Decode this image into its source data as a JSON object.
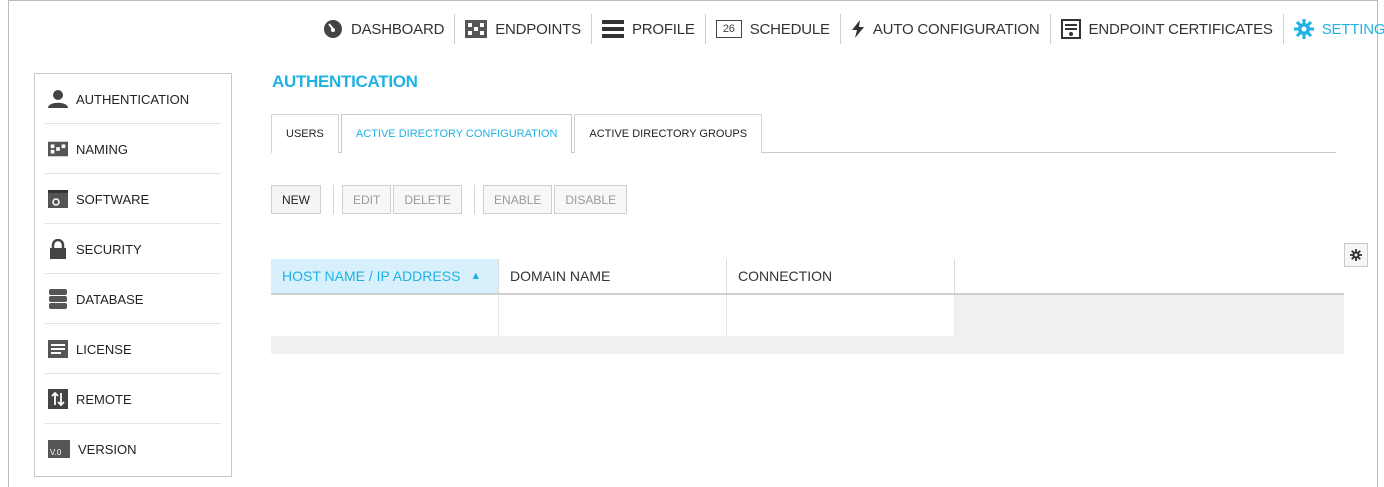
{
  "nav": {
    "items": [
      {
        "label": "DASHBOARD",
        "icon": "dashboard-icon"
      },
      {
        "label": "ENDPOINTS",
        "icon": "endpoints-icon"
      },
      {
        "label": "PROFILE",
        "icon": "profile-icon"
      },
      {
        "label": "SCHEDULE",
        "icon": "calendar-icon",
        "icon_text": "26"
      },
      {
        "label": "AUTO CONFIGURATION",
        "icon": "lightning-icon"
      },
      {
        "label": "ENDPOINT CERTIFICATES",
        "icon": "certificate-icon"
      },
      {
        "label": "SETTINGS",
        "icon": "gear-icon",
        "active": true
      }
    ]
  },
  "sidebar": {
    "items": [
      {
        "label": "AUTHENTICATION",
        "icon": "user-icon"
      },
      {
        "label": "NAMING",
        "icon": "naming-icon"
      },
      {
        "label": "SOFTWARE",
        "icon": "software-icon"
      },
      {
        "label": "SECURITY",
        "icon": "lock-icon"
      },
      {
        "label": "DATABASE",
        "icon": "database-icon"
      },
      {
        "label": "LICENSE",
        "icon": "license-icon"
      },
      {
        "label": "REMOTE",
        "icon": "remote-icon"
      },
      {
        "label": "VERSION",
        "icon": "version-icon",
        "icon_text": "V.0"
      }
    ]
  },
  "main": {
    "title": "AUTHENTICATION",
    "tabs": [
      {
        "label": "USERS"
      },
      {
        "label": "ACTIVE DIRECTORY CONFIGURATION",
        "active": true
      },
      {
        "label": "ACTIVE DIRECTORY GROUPS"
      }
    ],
    "toolbar": {
      "new": "NEW",
      "edit": "EDIT",
      "delete": "DELETE",
      "enable": "ENABLE",
      "disable": "DISABLE"
    },
    "table": {
      "columns": [
        {
          "label": "HOST NAME / IP ADDRESS",
          "sorted": "asc"
        },
        {
          "label": "DOMAIN NAME"
        },
        {
          "label": "CONNECTION"
        },
        {
          "label": ""
        }
      ],
      "rows": []
    }
  },
  "colors": {
    "accent": "#1fb2e3",
    "sorted_header_bg": "#d7f0fb"
  }
}
